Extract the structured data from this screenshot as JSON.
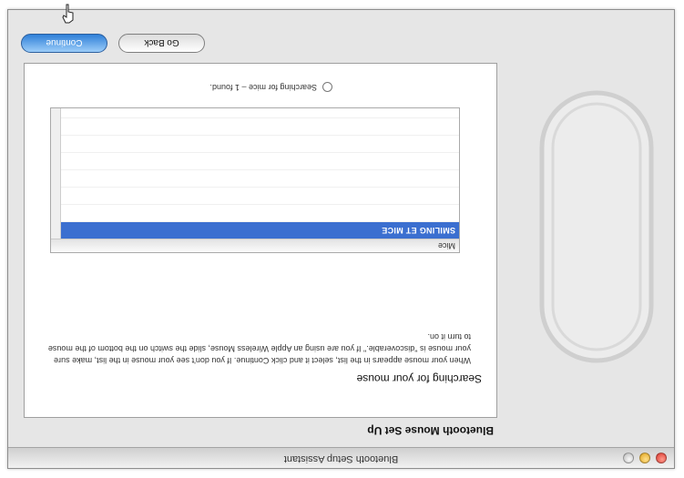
{
  "window": {
    "title": "Bluetooth Setup Assistant"
  },
  "content": {
    "heading": "Bluetooth Mouse Set Up",
    "subheading": "Searching for your mouse",
    "instructions": "When your mouse appears in the list, select it and click Continue. If you don't see your mouse in the list, make sure your mouse is \"discoverable.\" If you are using an Apple Wireless Mouse, slide the switch on the bottom of the mouse to turn it on."
  },
  "device_list": {
    "column_header": "Mice",
    "rows": [
      "SMILING ET MICE",
      "",
      "",
      "",
      "",
      "",
      ""
    ],
    "selected_index": 0
  },
  "status": {
    "text": "Searching for mice – 1 found."
  },
  "buttons": {
    "back": "Go Back",
    "continue": "Continue"
  },
  "icons": {
    "close": "close-icon",
    "minimize": "minimize-icon",
    "zoom": "zoom-icon",
    "mouse_illustration": "mouse-illustration-icon",
    "cursor": "hand-cursor-icon",
    "spinner": "spinner-icon"
  },
  "colors": {
    "selection": "#3b6fd0",
    "continue_button": "#2f80d8"
  }
}
